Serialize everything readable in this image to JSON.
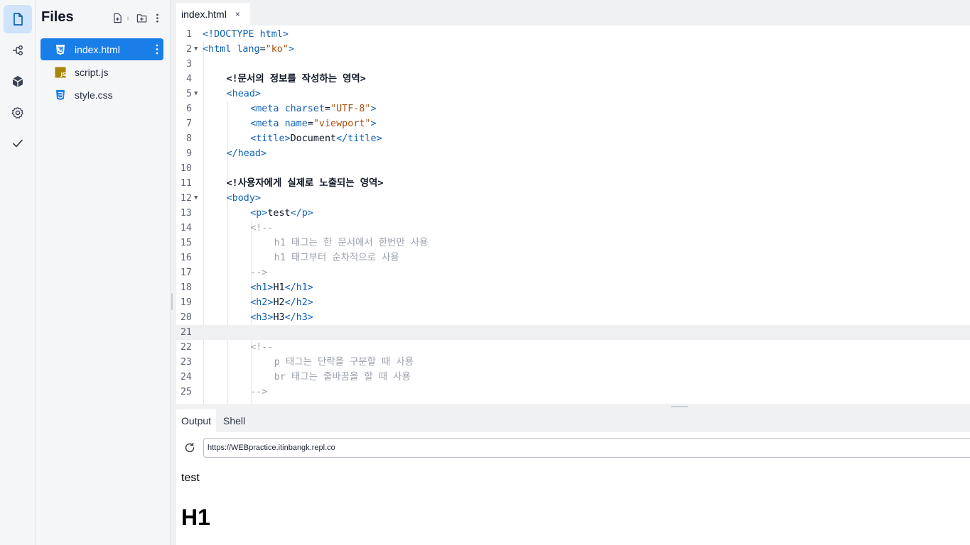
{
  "sidebar": {
    "title": "Files",
    "files": [
      {
        "name": "index.html",
        "type": "html",
        "active": true
      },
      {
        "name": "script.js",
        "type": "js",
        "active": false
      },
      {
        "name": "style.css",
        "type": "css",
        "active": false
      }
    ],
    "js_badge": "JS"
  },
  "editor": {
    "tab": {
      "label": "index.html",
      "close": "×"
    },
    "current_line": 21,
    "lines": [
      {
        "n": "1",
        "fold": "",
        "indent": 0,
        "tokens": [
          [
            "k",
            "<!DOCTYPE html>"
          ]
        ]
      },
      {
        "n": "2",
        "fold": "▼",
        "indent": 0,
        "tokens": [
          [
            "k",
            "<html"
          ],
          [
            "t",
            " "
          ],
          [
            "a",
            "lang"
          ],
          [
            "t",
            "="
          ],
          [
            "s",
            "\"ko\""
          ],
          [
            "k",
            ">"
          ]
        ]
      },
      {
        "n": "3",
        "fold": "",
        "indent": 0,
        "tokens": []
      },
      {
        "n": "4",
        "fold": "",
        "indent": 1,
        "tokens": [
          [
            "b",
            "<!문서의 정보를 작성하는 영역>"
          ]
        ]
      },
      {
        "n": "5",
        "fold": "▼",
        "indent": 1,
        "tokens": [
          [
            "k",
            "<head>"
          ]
        ]
      },
      {
        "n": "6",
        "fold": "",
        "indent": 2,
        "tokens": [
          [
            "k",
            "<meta"
          ],
          [
            "t",
            " "
          ],
          [
            "a",
            "charset"
          ],
          [
            "t",
            "="
          ],
          [
            "s",
            "\"UTF-8\""
          ],
          [
            "k",
            ">"
          ]
        ]
      },
      {
        "n": "7",
        "fold": "",
        "indent": 2,
        "tokens": [
          [
            "k",
            "<meta"
          ],
          [
            "t",
            " "
          ],
          [
            "a",
            "name"
          ],
          [
            "t",
            "="
          ],
          [
            "s",
            "\"viewport\""
          ],
          [
            "k",
            ">"
          ]
        ]
      },
      {
        "n": "8",
        "fold": "",
        "indent": 2,
        "tokens": [
          [
            "k",
            "<title>"
          ],
          [
            "t",
            "Document"
          ],
          [
            "k",
            "</title>"
          ]
        ]
      },
      {
        "n": "9",
        "fold": "",
        "indent": 1,
        "tokens": [
          [
            "k",
            "</head>"
          ]
        ]
      },
      {
        "n": "10",
        "fold": "",
        "indent": 0,
        "tokens": []
      },
      {
        "n": "11",
        "fold": "",
        "indent": 1,
        "tokens": [
          [
            "b",
            "<!사용자에게 실제로 노출되는 영역>"
          ]
        ]
      },
      {
        "n": "12",
        "fold": "▼",
        "indent": 1,
        "tokens": [
          [
            "k",
            "<body>"
          ]
        ]
      },
      {
        "n": "13",
        "fold": "",
        "indent": 2,
        "tokens": [
          [
            "k",
            "<p>"
          ],
          [
            "t",
            "test"
          ],
          [
            "k",
            "</p>"
          ]
        ]
      },
      {
        "n": "14",
        "fold": "",
        "indent": 2,
        "tokens": [
          [
            "c",
            "<!--"
          ]
        ]
      },
      {
        "n": "15",
        "fold": "",
        "indent": 3,
        "tokens": [
          [
            "c",
            "h1 태그는 한 문서에서 한번만 사용"
          ]
        ]
      },
      {
        "n": "16",
        "fold": "",
        "indent": 3,
        "tokens": [
          [
            "c",
            "h1 태그부터 순차적으로 사용"
          ]
        ]
      },
      {
        "n": "17",
        "fold": "",
        "indent": 2,
        "tokens": [
          [
            "c",
            "-->"
          ]
        ]
      },
      {
        "n": "18",
        "fold": "",
        "indent": 2,
        "tokens": [
          [
            "k",
            "<h1>"
          ],
          [
            "t",
            "H1"
          ],
          [
            "k",
            "</h1>"
          ]
        ]
      },
      {
        "n": "19",
        "fold": "",
        "indent": 2,
        "tokens": [
          [
            "k",
            "<h2>"
          ],
          [
            "t",
            "H2"
          ],
          [
            "k",
            "</h2>"
          ]
        ]
      },
      {
        "n": "20",
        "fold": "",
        "indent": 2,
        "tokens": [
          [
            "k",
            "<h3>"
          ],
          [
            "t",
            "H3"
          ],
          [
            "k",
            "</h3>"
          ]
        ]
      },
      {
        "n": "21",
        "fold": "",
        "indent": 0,
        "tokens": []
      },
      {
        "n": "22",
        "fold": "",
        "indent": 2,
        "tokens": [
          [
            "c",
            "<!--"
          ]
        ]
      },
      {
        "n": "23",
        "fold": "",
        "indent": 3,
        "tokens": [
          [
            "c",
            "p 태그는 단락을 구분할 때 사용"
          ]
        ]
      },
      {
        "n": "24",
        "fold": "",
        "indent": 3,
        "tokens": [
          [
            "c",
            "br 태그는 줄바꿈을 할 때 사용"
          ]
        ]
      },
      {
        "n": "25",
        "fold": "",
        "indent": 2,
        "tokens": [
          [
            "c",
            "-->"
          ]
        ]
      }
    ]
  },
  "output": {
    "tabs": [
      "Output",
      "Shell"
    ],
    "url": "https://WEBpractice.itinbangk.repl.co",
    "preview": {
      "p": "test",
      "h1": "H1"
    }
  }
}
